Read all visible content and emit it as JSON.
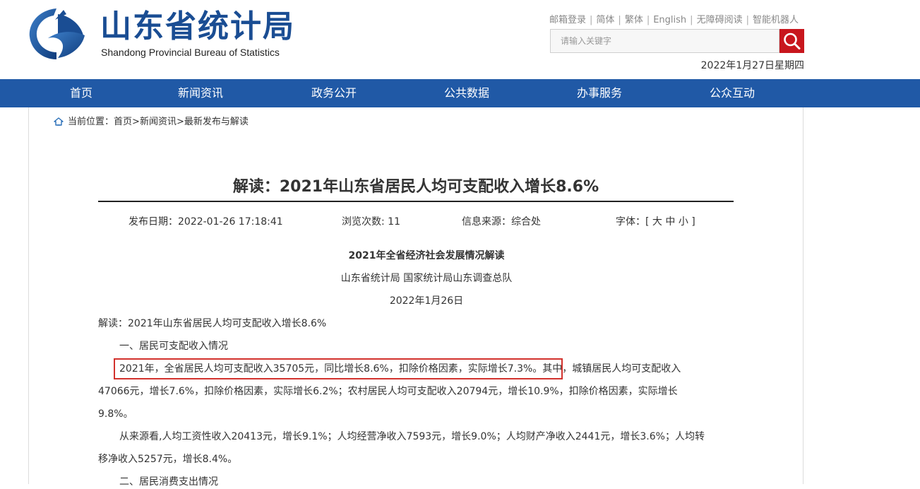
{
  "header": {
    "logo_cn": "山东省统计局",
    "logo_en": "Shandong Provincial Bureau of Statistics",
    "top_links": [
      "邮箱登录",
      "简体",
      "繁体",
      "English",
      "无障碍阅读",
      "智能机器人"
    ],
    "search": {
      "placeholder": "请输入关键字"
    },
    "date": "2022年1月27日星期四"
  },
  "nav": {
    "items": [
      "首页",
      "新闻资讯",
      "政务公开",
      "公共数据",
      "办事服务",
      "公众互动"
    ]
  },
  "breadcrumb": {
    "prefix": "当前位置：",
    "home": "首页",
    "sep": ">",
    "level1": "新闻资讯",
    "level2": "最新发布与解读"
  },
  "article": {
    "title": "解读：2021年山东省居民人均可支配收入增长8.6%",
    "meta": {
      "publish": "发布日期：2022-01-26 17:18:41",
      "views": "浏览次数: 11",
      "source": "信息来源：综合处",
      "font_label": "字体：[",
      "font_large": "大",
      "font_medium": "中",
      "font_small": "小",
      "font_close": "]"
    },
    "subtitle": "2021年全省经济社会发展情况解读",
    "author": "山东省统计局 国家统计局山东调查总队",
    "pub_date": "2022年1月26日",
    "lines": [
      "解读：2021年山东省居民人均可支配收入增长8.6%",
      "一、居民可支配收入情况",
      "2021年，全省居民人均可支配收入35705元，同比增长8.6%，扣除价格因素，实际增长7.3%。其中，城镇居民人均可支配收入",
      "47066元，增长7.6%，扣除价格因素，实际增长6.2%；农村居民人均可支配收入20794元，增长10.9%，扣除价格因素，实际增长",
      "9.8%。",
      "从来源看,人均工资性收入20413元，增长9.1%；人均经营净收入7593元，增长9.0%；人均财产净收入2441元，增长3.6%；人均转",
      "移净收入5257元，增长8.4%。",
      "二、居民消费支出情况"
    ]
  },
  "colors": {
    "nav_bg": "#2059a6",
    "logo_blue": "#1a4d93",
    "search_btn": "#c8161d",
    "highlight": "#d2322d"
  }
}
